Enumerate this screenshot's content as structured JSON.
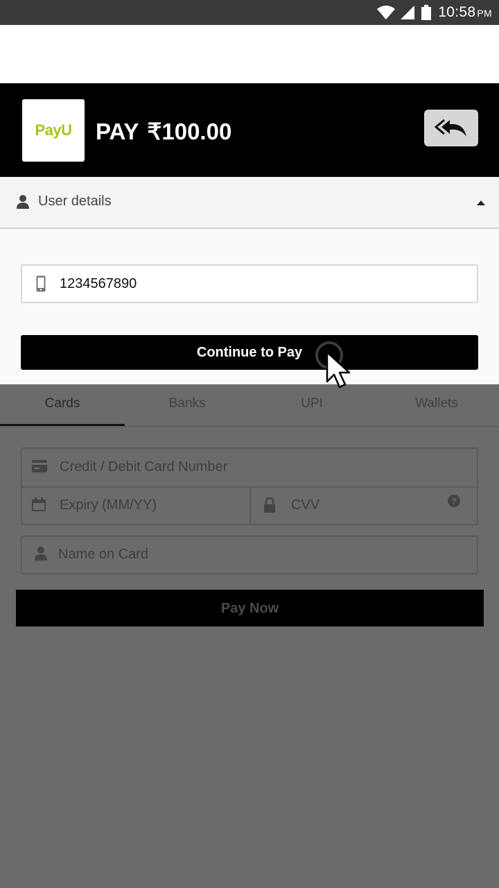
{
  "status_bar": {
    "time": "10:58",
    "ampm": "PM"
  },
  "header": {
    "logo_text": "PayU",
    "pay_label": "PAY",
    "amount": "₹100.00"
  },
  "user_details": {
    "title": "User details",
    "phone_value": "1234567890",
    "continue_label": "Continue to Pay"
  },
  "tabs": [
    {
      "label": "Cards",
      "active": true
    },
    {
      "label": "Banks"
    },
    {
      "label": "UPI"
    },
    {
      "label": "Wallets"
    }
  ],
  "card_form": {
    "card_number_placeholder": "Credit / Debit Card Number",
    "expiry_placeholder": "Expiry (MM/YY)",
    "cvv_placeholder": "CVV",
    "name_placeholder": "Name on Card",
    "pay_now_label": "Pay Now"
  }
}
